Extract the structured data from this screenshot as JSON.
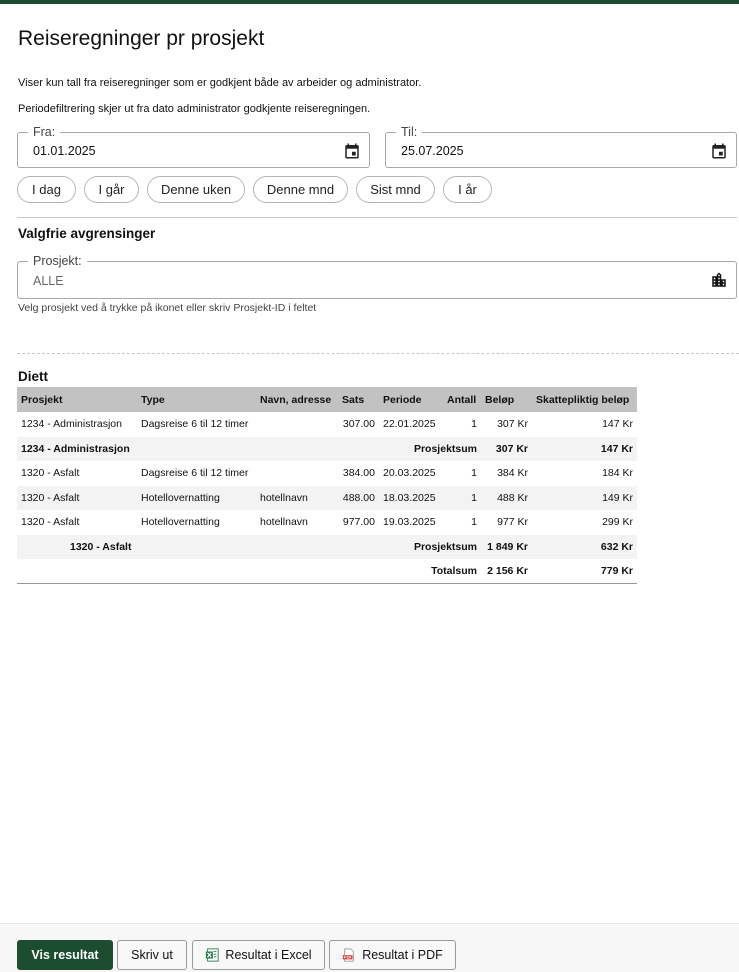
{
  "page": {
    "title": "Reiseregninger pr prosjekt",
    "info_line_1": "Viser kun tall fra reiseregninger som er godkjent både av arbeider og administrator.",
    "info_line_2": "Periodefiltrering skjer ut fra dato administrator godkjente reiseregningen."
  },
  "filters": {
    "from": {
      "label": "Fra:",
      "value": "01.01.2025",
      "icon": "calendar-icon"
    },
    "to": {
      "label": "Til:",
      "value": "25.07.2025",
      "icon": "calendar-icon"
    },
    "quick_ranges": [
      "I dag",
      "I går",
      "Denne uken",
      "Denne mnd",
      "Sist mnd",
      "I år"
    ]
  },
  "optional": {
    "section_title": "Valgfrie avgrensinger",
    "project": {
      "label": "Prosjekt:",
      "placeholder": "ALLE",
      "icon": "building-icon"
    },
    "hint": "Velg prosjekt ved å trykke på ikonet eller skriv Prosjekt-ID i feltet"
  },
  "diett": {
    "title": "Diett",
    "columns": [
      "Prosjekt",
      "Type",
      "Navn, adresse",
      "Sats",
      "Periode",
      "Antall",
      "Beløp",
      "Skattepliktig beløp"
    ],
    "rows": [
      {
        "kind": "row",
        "prosjekt": "1234 - Administrasjon",
        "type": "Dagsreise 6 til 12 timer",
        "navn": "",
        "sats": "307.00",
        "periode": "22.01.2025",
        "antall": "1",
        "belop": "307 Kr",
        "skatt": "147 Kr"
      },
      {
        "kind": "sum",
        "prosjekt": "1234 - Administrasjon",
        "label": "Prosjektsum",
        "belop": "307 Kr",
        "skatt": "147 Kr"
      },
      {
        "kind": "row",
        "prosjekt": "1320 - Asfalt",
        "type": "Dagsreise 6 til 12 timer",
        "navn": "",
        "sats": "384.00",
        "periode": "20.03.2025",
        "antall": "1",
        "belop": "384 Kr",
        "skatt": "184 Kr"
      },
      {
        "kind": "row",
        "prosjekt": "1320 - Asfalt",
        "type": "Hotellovernatting",
        "navn": "hotellnavn",
        "sats": "488.00",
        "periode": "18.03.2025",
        "antall": "1",
        "belop": "488 Kr",
        "skatt": "149 Kr"
      },
      {
        "kind": "row",
        "prosjekt": "1320 - Asfalt",
        "type": "Hotellovernatting",
        "navn": "hotellnavn",
        "sats": "977.00",
        "periode": "19.03.2025",
        "antall": "1",
        "belop": "977 Kr",
        "skatt": "299 Kr"
      },
      {
        "kind": "sum",
        "prosjekt": "1320 - Asfalt",
        "label": "Prosjektsum",
        "belop": "1 849 Kr",
        "skatt": "632 Kr"
      }
    ],
    "total": {
      "label": "Totalsum",
      "belop": "2 156 Kr",
      "skatt": "779 Kr"
    }
  },
  "footer": {
    "show_results": "Vis resultat",
    "print": "Skriv ut",
    "excel": "Resultat i Excel",
    "pdf": "Resultat i PDF"
  },
  "colors": {
    "brand": "#1b4d2e",
    "table_header": "#c2c2c2"
  }
}
